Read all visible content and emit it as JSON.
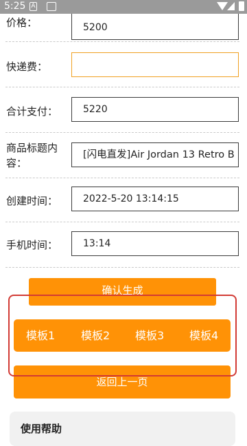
{
  "status_bar": {
    "time": "5:25"
  },
  "form": {
    "price": {
      "label": "价格：",
      "value": "5200"
    },
    "shipping": {
      "label": "快递费：",
      "value": ""
    },
    "total": {
      "label": "合计支付：",
      "value": "5220"
    },
    "title": {
      "label": "商品标题内容：",
      "value": "[闪电直发]Air Jordan 13 Retro B"
    },
    "created": {
      "label": "创建时间：",
      "value": "2022-5-20 13:14:15"
    },
    "phone_time": {
      "label": "手机时间：",
      "value": "13:14"
    }
  },
  "buttons": {
    "confirm": "确认生成",
    "templates": [
      "模板1",
      "模板2",
      "模板3",
      "模板4"
    ],
    "back": "返回上一页"
  },
  "help": {
    "title": "使用帮助"
  },
  "colors": {
    "accent": "#ff9206",
    "highlight": "#d23a34"
  },
  "icons": [
    "wifi-icon",
    "signal-icon",
    "battery-icon"
  ]
}
